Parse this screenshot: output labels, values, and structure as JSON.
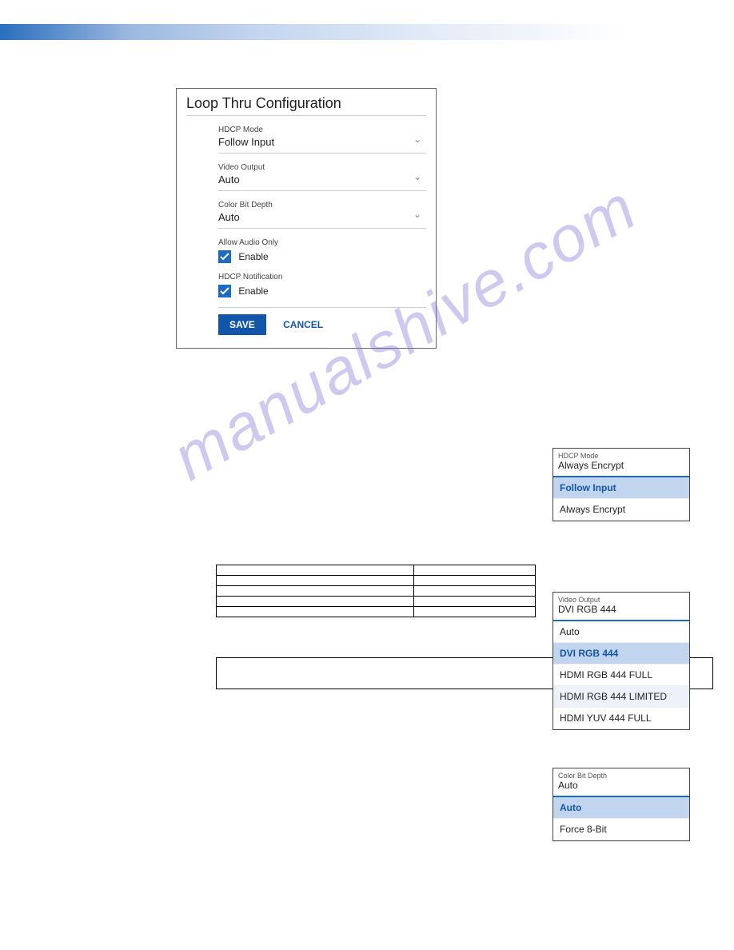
{
  "panel": {
    "title": "Loop Thru Configuration",
    "hdcpMode": {
      "label": "HDCP Mode",
      "value": "Follow Input"
    },
    "videoOutput": {
      "label": "Video Output",
      "value": "Auto"
    },
    "colorBitDepth": {
      "label": "Color Bit Depth",
      "value": "Auto"
    },
    "allowAudioOnly": {
      "label": "Allow Audio Only",
      "enableText": "Enable"
    },
    "hdcpNotification": {
      "label": "HDCP Notification",
      "enableText": "Enable"
    },
    "saveLabel": "SAVE",
    "cancelLabel": "CANCEL"
  },
  "hdcpDropdown": {
    "label": "HDCP Mode",
    "value": "Always Encrypt",
    "options": [
      "Follow Input",
      "Always Encrypt"
    ],
    "selectedIndex": 0
  },
  "videoOutputDropdown": {
    "label": "Video Output",
    "value": "DVI RGB 444",
    "options": [
      "Auto",
      "DVI RGB 444",
      "HDMI RGB 444 FULL",
      "HDMI RGB 444 LIMITED",
      "HDMI YUV 444 FULL"
    ],
    "selectedIndex": 1
  },
  "colorBitDropdown": {
    "label": "Color Bit Depth",
    "value": "Auto",
    "options": [
      "Auto",
      "Force 8-Bit"
    ],
    "selectedIndex": 0
  },
  "videoOutTable": {
    "headers": [
      "",
      ""
    ],
    "rows": [
      [
        "",
        ""
      ],
      [
        "",
        ""
      ],
      [
        "",
        ""
      ],
      [
        "",
        ""
      ]
    ]
  },
  "watermark": "manualshive.com"
}
